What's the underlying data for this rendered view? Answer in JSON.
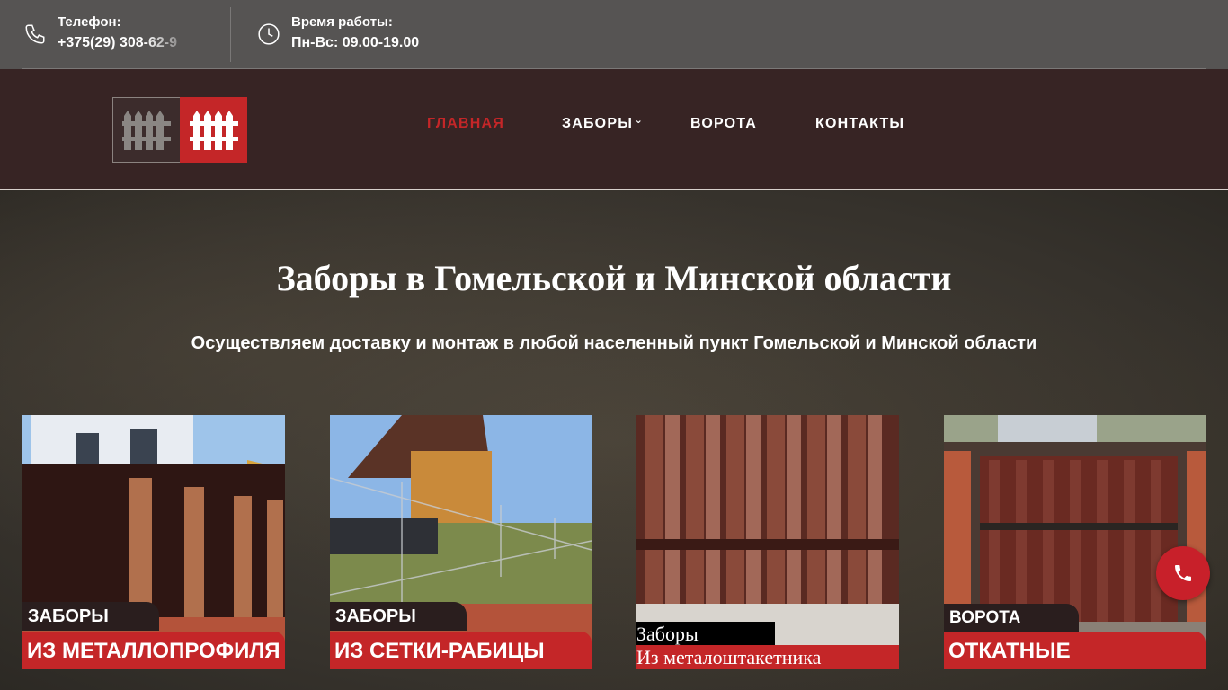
{
  "topbar": {
    "phone_label": "Телефон:",
    "phone_value": "+375(29) 308-62-9",
    "hours_label": "Время работы:",
    "hours_value": "Пн-Вс: 09.00-19.00"
  },
  "header": {
    "nav": [
      {
        "label": "ГЛАВНАЯ",
        "active": true
      },
      {
        "label": "ЗАБОРЫ",
        "has_submenu": true
      },
      {
        "label": "ВОРОТА"
      },
      {
        "label": "КОНТАКТЫ"
      }
    ]
  },
  "hero": {
    "title": "Заборы в Гомельской и Минской области",
    "subtitle": "Осуществляем доставку и монтаж в любой населенный пункт Гомельской и Минской области"
  },
  "cards": [
    {
      "top": "ЗАБОРЫ",
      "bottom": "ИЗ МЕТАЛЛОПРОФИЛЯ"
    },
    {
      "top": "ЗАБОРЫ",
      "bottom": "ИЗ СЕТКИ-РАБИЦЫ"
    },
    {
      "top": "Заборы",
      "bottom": "Из металоштакетника"
    },
    {
      "top": "ВОРОТА",
      "bottom": "ОТКАТНЫЕ"
    }
  ],
  "icons": {
    "phone": "phone-icon",
    "clock": "clock-icon",
    "call": "call-button-icon"
  },
  "colors": {
    "accent": "#c42628",
    "topbar": "#565453",
    "header": "#372424"
  }
}
